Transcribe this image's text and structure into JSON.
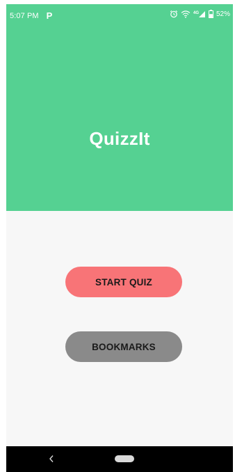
{
  "status_bar": {
    "time": "5:07 PM",
    "app_icon": "P",
    "network_label": "4G",
    "battery_percent": "52%",
    "icons": [
      "alarm-icon",
      "wifi-icon",
      "signal-icon",
      "battery-icon"
    ]
  },
  "app": {
    "title": "QuizzIt"
  },
  "buttons": {
    "start_quiz": "START QUIZ",
    "bookmarks": "BOOKMARKS"
  },
  "colors": {
    "header_green": "#55d192",
    "start_button": "#f87477",
    "bookmarks_button": "#8a8a8a",
    "background": "#f7f7f7",
    "nav_bar": "#000000"
  },
  "nav": {
    "icons": [
      "back-icon",
      "home-pill-icon"
    ]
  }
}
